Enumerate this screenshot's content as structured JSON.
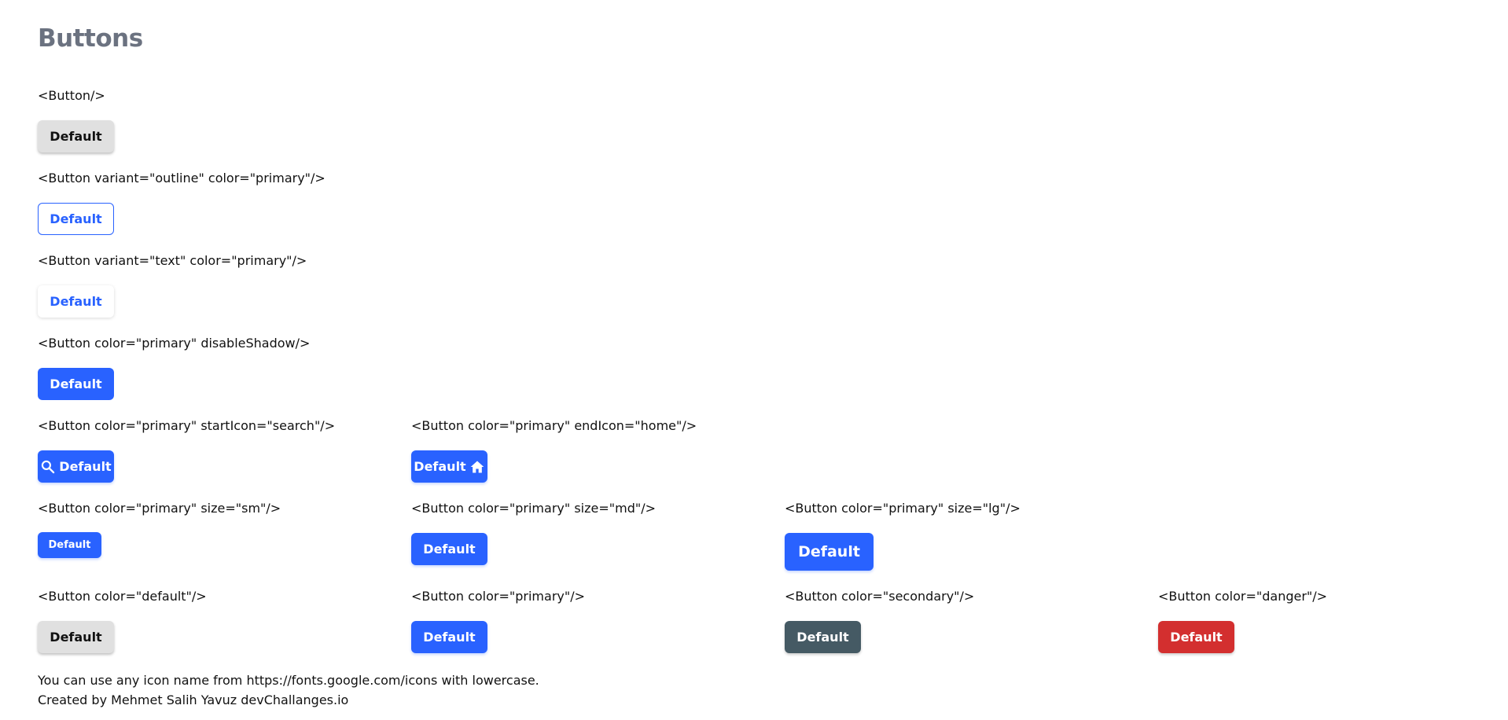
{
  "page": {
    "title": "Buttons"
  },
  "rows": [
    {
      "cells": [
        {
          "label": "<Button/>",
          "button": "Default"
        }
      ]
    },
    {
      "cells": [
        {
          "label": "<Button variant=\"outline\" color=\"primary\"/>",
          "button": "Default"
        }
      ]
    },
    {
      "cells": [
        {
          "label": "<Button variant=\"text\" color=\"primary\"/>",
          "button": "Default"
        }
      ]
    },
    {
      "cells": [
        {
          "label": "<Button color=\"primary\" disableShadow/>",
          "button": "Default"
        }
      ]
    },
    {
      "cells": [
        {
          "label": "<Button color=\"primary\" startIcon=\"search\"/>",
          "button": "Default",
          "icon": "search-icon"
        },
        {
          "label": "<Button color=\"primary\" endIcon=\"home\"/>",
          "button": "Default",
          "icon": "home-icon"
        }
      ]
    },
    {
      "cells": [
        {
          "label": "<Button color=\"primary\" size=\"sm\"/>",
          "button": "Default"
        },
        {
          "label": "<Button color=\"primary\" size=\"md\"/>",
          "button": "Default"
        },
        {
          "label": "<Button color=\"primary\" size=\"lg\"/>",
          "button": "Default"
        }
      ]
    },
    {
      "cells": [
        {
          "label": "<Button color=\"default\"/>",
          "button": "Default"
        },
        {
          "label": "<Button color=\"primary\"/>",
          "button": "Default"
        },
        {
          "label": "<Button color=\"secondary\"/>",
          "button": "Default"
        },
        {
          "label": "<Button color=\"danger\"/>",
          "button": "Default"
        }
      ]
    }
  ],
  "footer": {
    "line1": "You can use any icon name from https://fonts.google.com/icons with lowercase.",
    "line2": "Created by Mehmet Salih Yavuz devChallanges.io"
  },
  "colors": {
    "primary": "#2962ff",
    "secondary": "#455a64",
    "danger": "#d32f2f",
    "default": "#e0e0e0",
    "title": "#6b7280"
  }
}
